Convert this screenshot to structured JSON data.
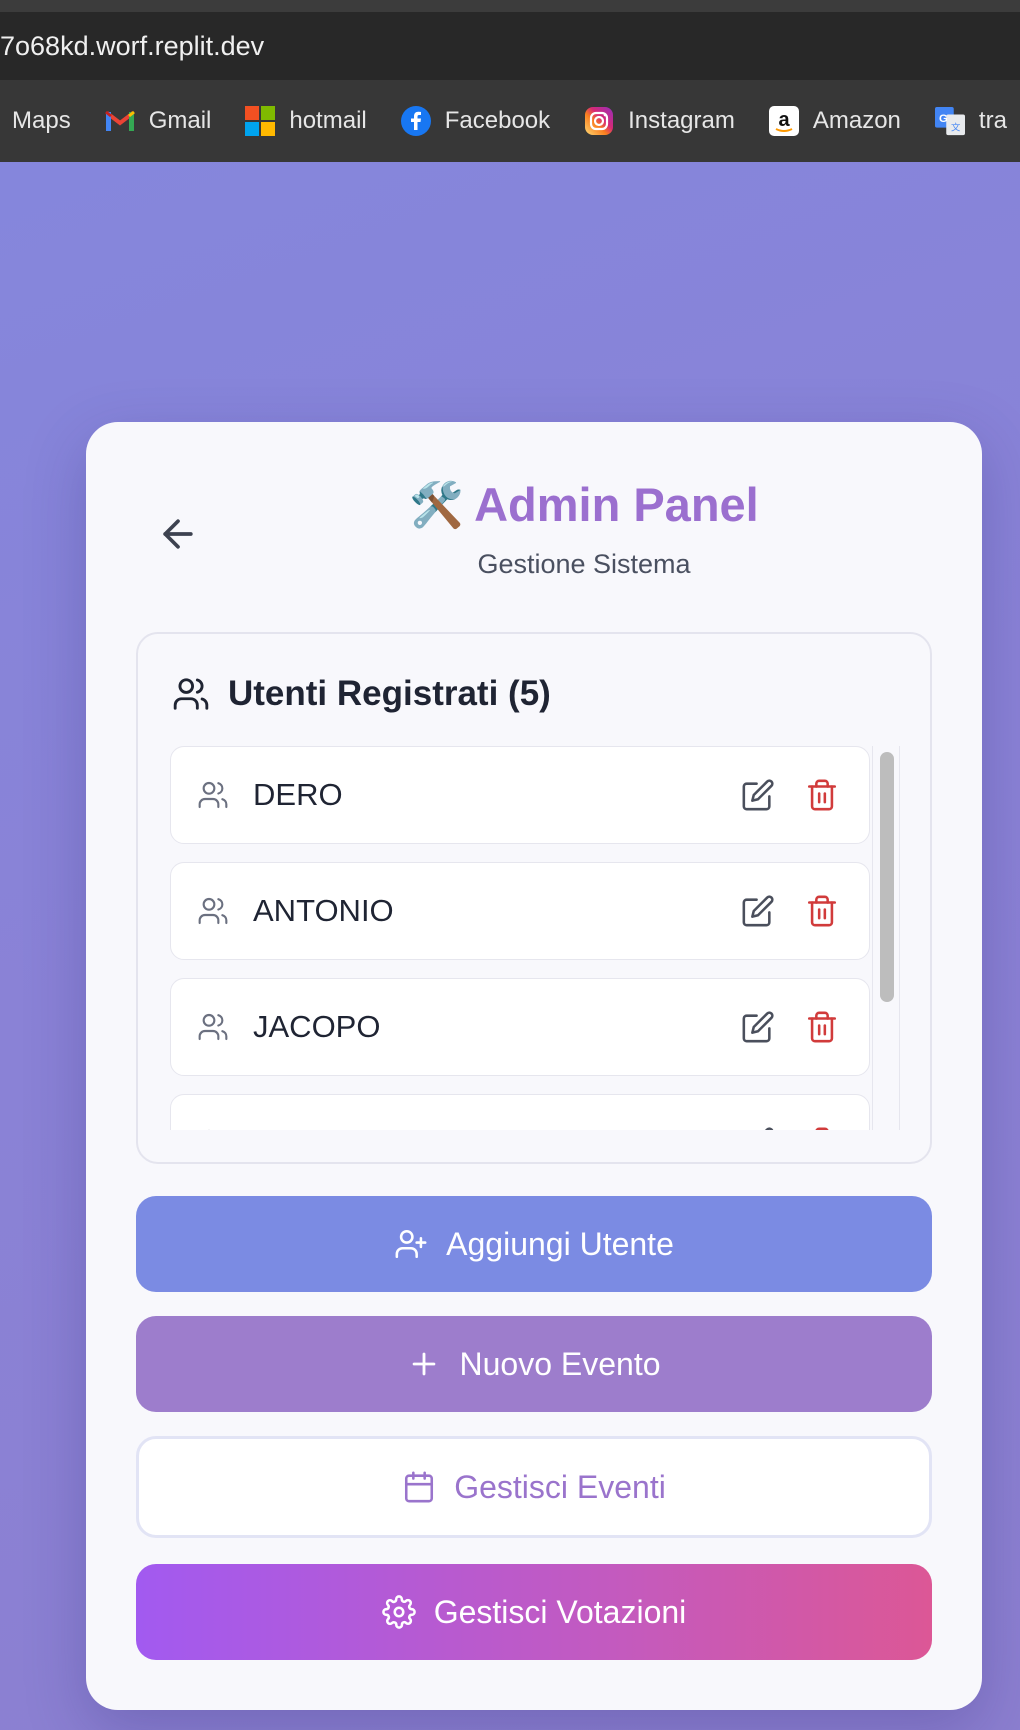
{
  "browser": {
    "url": "7o68kd.worf.replit.dev",
    "bookmarks": [
      {
        "label": "Maps",
        "icon": "maps-icon"
      },
      {
        "label": "Gmail",
        "icon": "gmail-icon"
      },
      {
        "label": "hotmail",
        "icon": "microsoft-icon"
      },
      {
        "label": "Facebook",
        "icon": "facebook-icon"
      },
      {
        "label": "Instagram",
        "icon": "instagram-icon"
      },
      {
        "label": "Amazon",
        "icon": "amazon-icon"
      },
      {
        "label": "tra",
        "icon": "translate-icon"
      }
    ]
  },
  "header": {
    "emoji": "🛠️",
    "title": "Admin Panel",
    "subtitle": "Gestione Sistema"
  },
  "users": {
    "heading": "Utenti Registrati (5)",
    "items": [
      {
        "name": "DERO"
      },
      {
        "name": "ANTONIO"
      },
      {
        "name": "JACOPO"
      },
      {
        "name": ""
      }
    ]
  },
  "actions": {
    "add_user": "Aggiungi Utente",
    "new_event": "Nuovo Evento",
    "manage_events": "Gestisci Eventi",
    "manage_votes": "Gestisci Votazioni"
  },
  "colors": {
    "accent_purple": "#9b6fcf",
    "add_user_bg": "#7b8be3",
    "new_event_bg": "#9d7dcc",
    "delete_red": "#d13b3b"
  }
}
